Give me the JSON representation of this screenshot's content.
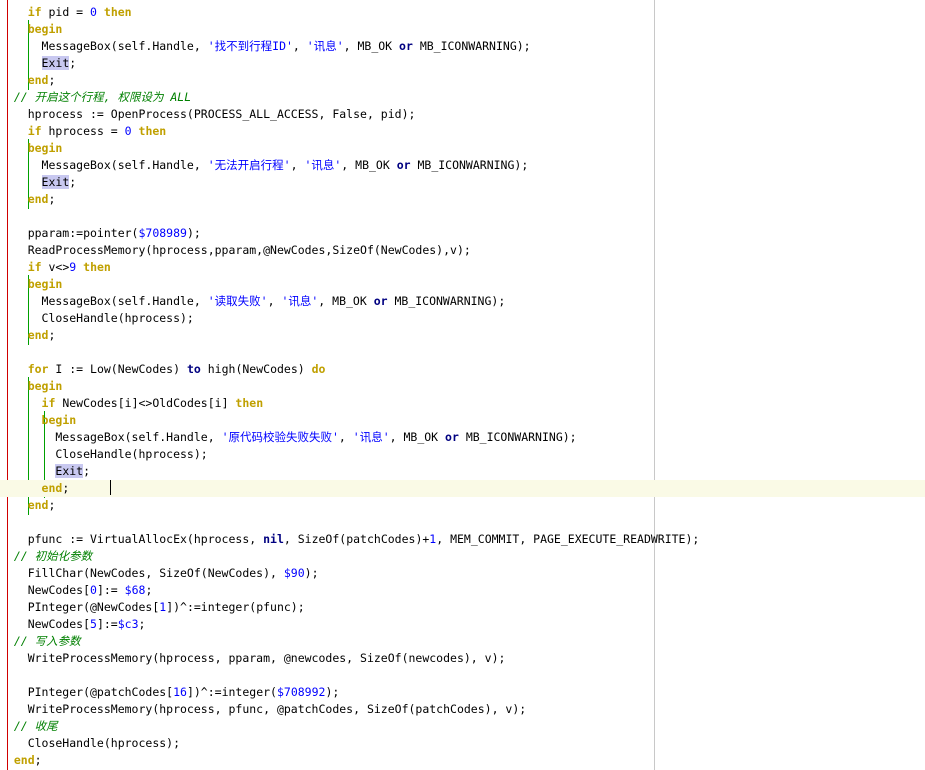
{
  "lines": [
    [
      {
        "t": "    ",
        "c": "txt"
      },
      {
        "t": "if",
        "c": "kw"
      },
      {
        "t": " pid = ",
        "c": "txt"
      },
      {
        "t": "0",
        "c": "num"
      },
      {
        "t": " ",
        "c": "txt"
      },
      {
        "t": "then",
        "c": "kw"
      }
    ],
    [
      {
        "t": "    ",
        "c": "txt"
      },
      {
        "t": "begin",
        "c": "kw"
      }
    ],
    [
      {
        "t": "      MessageBox(self.Handle, ",
        "c": "txt"
      },
      {
        "t": "'找不到行程ID'",
        "c": "str"
      },
      {
        "t": ", ",
        "c": "txt"
      },
      {
        "t": "'讯息'",
        "c": "str"
      },
      {
        "t": ", MB_OK ",
        "c": "txt"
      },
      {
        "t": "or",
        "c": "kw2"
      },
      {
        "t": " MB_ICONWARNING);",
        "c": "txt"
      }
    ],
    [
      {
        "t": "      ",
        "c": "txt"
      },
      {
        "t": "Exit",
        "c": "sel"
      },
      {
        "t": ";",
        "c": "txt"
      }
    ],
    [
      {
        "t": "    ",
        "c": "txt"
      },
      {
        "t": "end",
        "c": "kw"
      },
      {
        "t": ";",
        "c": "txt"
      }
    ],
    [
      {
        "t": "  // 开启这个行程, 权限设为 ALL",
        "c": "cmt"
      }
    ],
    [
      {
        "t": "    hprocess := OpenProcess(PROCESS_ALL_ACCESS, False, pid);",
        "c": "txt"
      }
    ],
    [
      {
        "t": "    ",
        "c": "txt"
      },
      {
        "t": "if",
        "c": "kw"
      },
      {
        "t": " hprocess = ",
        "c": "txt"
      },
      {
        "t": "0",
        "c": "num"
      },
      {
        "t": " ",
        "c": "txt"
      },
      {
        "t": "then",
        "c": "kw"
      }
    ],
    [
      {
        "t": "    ",
        "c": "txt"
      },
      {
        "t": "begin",
        "c": "kw"
      }
    ],
    [
      {
        "t": "      MessageBox(self.Handle, ",
        "c": "txt"
      },
      {
        "t": "'无法开启行程'",
        "c": "str"
      },
      {
        "t": ", ",
        "c": "txt"
      },
      {
        "t": "'讯息'",
        "c": "str"
      },
      {
        "t": ", MB_OK ",
        "c": "txt"
      },
      {
        "t": "or",
        "c": "kw2"
      },
      {
        "t": " MB_ICONWARNING);",
        "c": "txt"
      }
    ],
    [
      {
        "t": "      ",
        "c": "txt"
      },
      {
        "t": "Exit",
        "c": "sel"
      },
      {
        "t": ";",
        "c": "txt"
      }
    ],
    [
      {
        "t": "    ",
        "c": "txt"
      },
      {
        "t": "end",
        "c": "kw"
      },
      {
        "t": ";",
        "c": "txt"
      }
    ],
    [],
    [
      {
        "t": "    pparam:=pointer(",
        "c": "txt"
      },
      {
        "t": "$708989",
        "c": "num"
      },
      {
        "t": ");",
        "c": "txt"
      }
    ],
    [
      {
        "t": "    ReadProcessMemory(hprocess,pparam,@NewCodes,SizeOf(NewCodes),v);",
        "c": "txt"
      }
    ],
    [
      {
        "t": "    ",
        "c": "txt"
      },
      {
        "t": "if",
        "c": "kw"
      },
      {
        "t": " v<>",
        "c": "txt"
      },
      {
        "t": "9",
        "c": "num"
      },
      {
        "t": " ",
        "c": "txt"
      },
      {
        "t": "then",
        "c": "kw"
      }
    ],
    [
      {
        "t": "    ",
        "c": "txt"
      },
      {
        "t": "begin",
        "c": "kw"
      }
    ],
    [
      {
        "t": "      MessageBox(self.Handle, ",
        "c": "txt"
      },
      {
        "t": "'读取失败'",
        "c": "str"
      },
      {
        "t": ", ",
        "c": "txt"
      },
      {
        "t": "'讯息'",
        "c": "str"
      },
      {
        "t": ", MB_OK ",
        "c": "txt"
      },
      {
        "t": "or",
        "c": "kw2"
      },
      {
        "t": " MB_ICONWARNING);",
        "c": "txt"
      }
    ],
    [
      {
        "t": "      CloseHandle(hprocess);",
        "c": "txt"
      }
    ],
    [
      {
        "t": "    ",
        "c": "txt"
      },
      {
        "t": "end",
        "c": "kw"
      },
      {
        "t": ";",
        "c": "txt"
      }
    ],
    [],
    [
      {
        "t": "    ",
        "c": "txt"
      },
      {
        "t": "for",
        "c": "kw"
      },
      {
        "t": " I := Low(NewCodes) ",
        "c": "txt"
      },
      {
        "t": "to",
        "c": "kw2"
      },
      {
        "t": " high(NewCodes) ",
        "c": "txt"
      },
      {
        "t": "do",
        "c": "kw"
      }
    ],
    [
      {
        "t": "    ",
        "c": "txt"
      },
      {
        "t": "begin",
        "c": "kw"
      }
    ],
    [
      {
        "t": "      ",
        "c": "txt"
      },
      {
        "t": "if",
        "c": "kw"
      },
      {
        "t": " NewCodes[i]<>OldCodes[i] ",
        "c": "txt"
      },
      {
        "t": "then",
        "c": "kw"
      }
    ],
    [
      {
        "t": "      ",
        "c": "txt"
      },
      {
        "t": "begin",
        "c": "kw"
      }
    ],
    [
      {
        "t": "        MessageBox(self.Handle, ",
        "c": "txt"
      },
      {
        "t": "'原代码校验失败失败'",
        "c": "str"
      },
      {
        "t": ", ",
        "c": "txt"
      },
      {
        "t": "'讯息'",
        "c": "str"
      },
      {
        "t": ", MB_OK ",
        "c": "txt"
      },
      {
        "t": "or",
        "c": "kw2"
      },
      {
        "t": " MB_ICONWARNING);",
        "c": "txt"
      }
    ],
    [
      {
        "t": "        CloseHandle(hprocess);",
        "c": "txt"
      }
    ],
    [
      {
        "t": "        ",
        "c": "txt"
      },
      {
        "t": "Exit",
        "c": "sel"
      },
      {
        "t": ";",
        "c": "txt"
      }
    ],
    [
      {
        "t": "      ",
        "c": "txt"
      },
      {
        "t": "end",
        "c": "kw"
      },
      {
        "t": ";",
        "c": "txt"
      }
    ],
    [
      {
        "t": "    ",
        "c": "txt"
      },
      {
        "t": "end",
        "c": "kw"
      },
      {
        "t": ";",
        "c": "txt"
      }
    ],
    [],
    [
      {
        "t": "    pfunc := VirtualAllocEx(hprocess, ",
        "c": "txt"
      },
      {
        "t": "nil",
        "c": "kw2"
      },
      {
        "t": ", SizeOf(patchCodes)+",
        "c": "txt"
      },
      {
        "t": "1",
        "c": "num"
      },
      {
        "t": ", MEM_COMMIT, PAGE_EXECUTE_READWRITE);",
        "c": "txt"
      }
    ],
    [
      {
        "t": "  // 初始化参数",
        "c": "cmt"
      }
    ],
    [
      {
        "t": "    FillChar(NewCodes, SizeOf(NewCodes), ",
        "c": "txt"
      },
      {
        "t": "$90",
        "c": "num"
      },
      {
        "t": ");",
        "c": "txt"
      }
    ],
    [
      {
        "t": "    NewCodes[",
        "c": "txt"
      },
      {
        "t": "0",
        "c": "num"
      },
      {
        "t": "]:= ",
        "c": "txt"
      },
      {
        "t": "$68",
        "c": "num"
      },
      {
        "t": ";",
        "c": "txt"
      }
    ],
    [
      {
        "t": "    PInteger(@NewCodes[",
        "c": "txt"
      },
      {
        "t": "1",
        "c": "num"
      },
      {
        "t": "])^:=integer(pfunc);",
        "c": "txt"
      }
    ],
    [
      {
        "t": "    NewCodes[",
        "c": "txt"
      },
      {
        "t": "5",
        "c": "num"
      },
      {
        "t": "]:=",
        "c": "txt"
      },
      {
        "t": "$c3",
        "c": "num"
      },
      {
        "t": ";",
        "c": "txt"
      }
    ],
    [
      {
        "t": "  // 写入参数",
        "c": "cmt"
      }
    ],
    [
      {
        "t": "    WriteProcessMemory(hprocess, pparam, @newcodes, SizeOf(newcodes), v);",
        "c": "txt"
      }
    ],
    [],
    [
      {
        "t": "    PInteger(@patchCodes[",
        "c": "txt"
      },
      {
        "t": "16",
        "c": "num"
      },
      {
        "t": "])^:=integer(",
        "c": "txt"
      },
      {
        "t": "$708992",
        "c": "num"
      },
      {
        "t": ");",
        "c": "txt"
      }
    ],
    [
      {
        "t": "    WriteProcessMemory(hprocess, pfunc, @patchCodes, SizeOf(patchCodes), v);",
        "c": "txt"
      }
    ],
    [
      {
        "t": "  // 收尾",
        "c": "cmt"
      }
    ],
    [
      {
        "t": "    CloseHandle(hprocess);",
        "c": "txt"
      }
    ],
    [
      {
        "t": "  ",
        "c": "txt"
      },
      {
        "t": "end",
        "c": "kw"
      },
      {
        "t": ";",
        "c": "txt"
      }
    ]
  ]
}
